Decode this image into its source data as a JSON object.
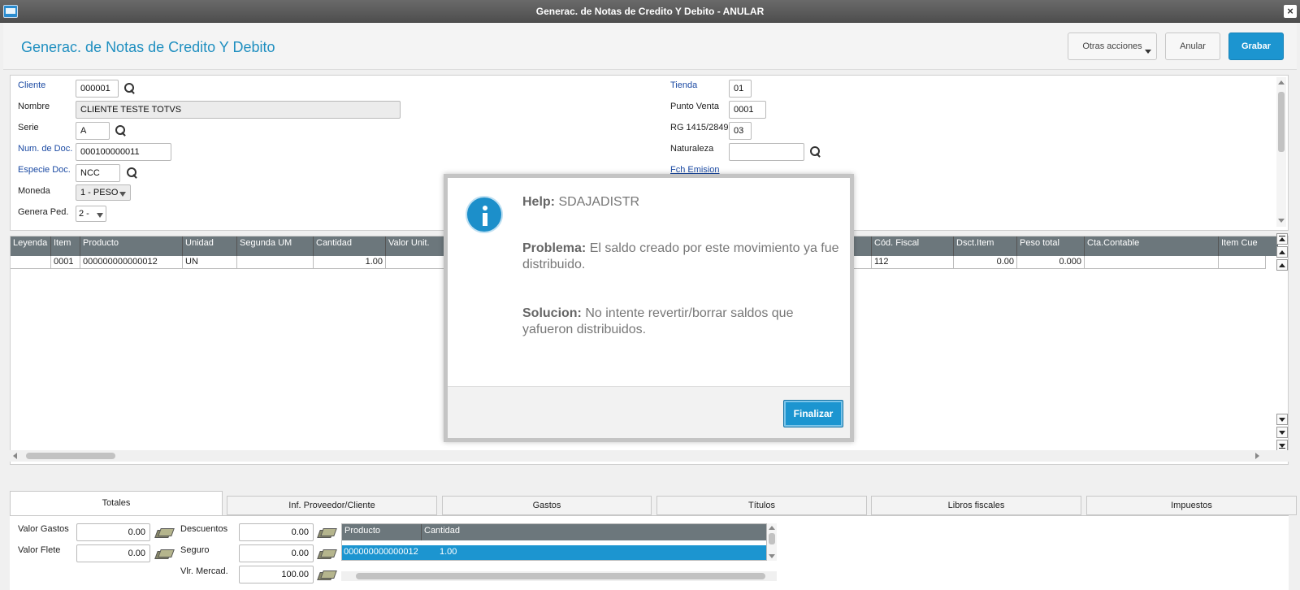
{
  "window": {
    "title": "Generac. de Notas de Credito Y Debito - ANULAR",
    "close": "×"
  },
  "header": {
    "title": "Generac. de Notas de Credito Y Debito",
    "buttons": {
      "otras": "Otras acciones",
      "anular": "Anular",
      "grabar": "Grabar"
    }
  },
  "form": {
    "cliente": {
      "label": "Cliente",
      "value": "000001"
    },
    "nombre": {
      "label": "Nombre",
      "value": "CLIENTE TESTE TOTVS"
    },
    "serie": {
      "label": "Serie",
      "value": "A"
    },
    "num_doc": {
      "label": "Num. de Doc.",
      "value": "000100000011"
    },
    "especie": {
      "label": "Especie Doc.",
      "value": "NCC"
    },
    "moneda": {
      "label": "Moneda",
      "value": "1 - PESO"
    },
    "genera_ped": {
      "label": "Genera Ped.",
      "value": "2 -"
    },
    "tienda": {
      "label": "Tienda",
      "value": "01"
    },
    "punto_venta": {
      "label": "Punto Venta",
      "value": "0001"
    },
    "rg": {
      "label": "RG 1415/2849",
      "value": "03"
    },
    "naturaleza": {
      "label": "Naturaleza",
      "value": ""
    },
    "fch_emision": {
      "label": "Fch Emision",
      "value": ""
    }
  },
  "grid": {
    "columns": [
      "Leyenda",
      "Item",
      "Producto",
      "Unidad",
      "Segunda UM",
      "Cantidad",
      "Valor Unit.",
      "Cód. Fiscal",
      "Dsct.Item",
      "Peso total",
      "Cta.Contable",
      "Item Cue"
    ],
    "row": {
      "leyenda": "",
      "item": "0001",
      "producto": "000000000000012",
      "unidad": "UN",
      "segunda_um": "",
      "cantidad": "1.00",
      "valor_unit": "",
      "cod_fiscal": "112",
      "dsct_item": "0.00",
      "peso_total": "0.000",
      "cta_contable": "",
      "item_cue": ""
    }
  },
  "tabs": [
    "Totales",
    "Inf. Proveedor/Cliente",
    "Gastos",
    "Títulos",
    "Libros fiscales",
    "Impuestos"
  ],
  "totales": {
    "valor_gastos": {
      "label": "Valor Gastos",
      "value": "0.00"
    },
    "valor_flete": {
      "label": "Valor Flete",
      "value": "0.00"
    },
    "descuentos": {
      "label": "Descuentos",
      "value": "0.00"
    },
    "seguro": {
      "label": "Seguro",
      "value": "0.00"
    },
    "vlr_mercad": {
      "label": "Vlr. Mercad.",
      "value": "100.00"
    },
    "mini_grid": {
      "columns": [
        "Producto",
        "Cantidad"
      ],
      "row": {
        "producto": "000000000000012",
        "cantidad": "1.00"
      }
    }
  },
  "modal": {
    "help_label": "Help:",
    "help_value": "SDAJADISTR",
    "problema_label": "Problema:",
    "problema_text": "El saldo creado por este movimiento ya fue distribuido.",
    "solucion_label": "Solucion:",
    "solucion_text": "No intente revertir/borrar saldos que yafueron distribuidos.",
    "button": "Finalizar"
  },
  "colors": {
    "accent": "#1c95d0",
    "title": "#1f8fc0",
    "grid_header": "#6c777c"
  }
}
